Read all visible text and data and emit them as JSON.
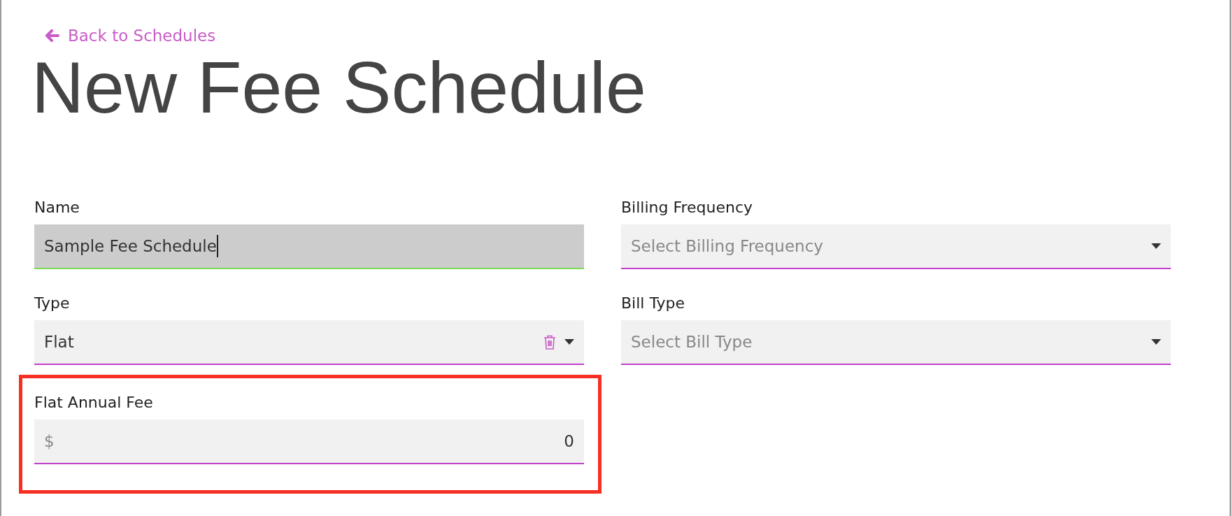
{
  "back_link": {
    "label": "Back to Schedules"
  },
  "title": "New Fee Schedule",
  "fields": [
    {
      "kind": "text",
      "label": "Name",
      "value": "Sample Fee Schedule",
      "focused": true,
      "highlighted": false
    },
    {
      "kind": "select",
      "label": "Billing Frequency",
      "placeholder": "Select Billing Frequency",
      "clearable": false,
      "highlighted": false
    },
    {
      "kind": "select",
      "label": "Type",
      "value": "Flat",
      "clearable": true,
      "highlighted": false
    },
    {
      "kind": "select",
      "label": "Bill Type",
      "placeholder": "Select Bill Type",
      "clearable": false,
      "highlighted": false
    },
    {
      "kind": "currency",
      "label": "Flat Annual Fee",
      "prefix": "$",
      "value": "0",
      "highlighted": true
    }
  ]
}
